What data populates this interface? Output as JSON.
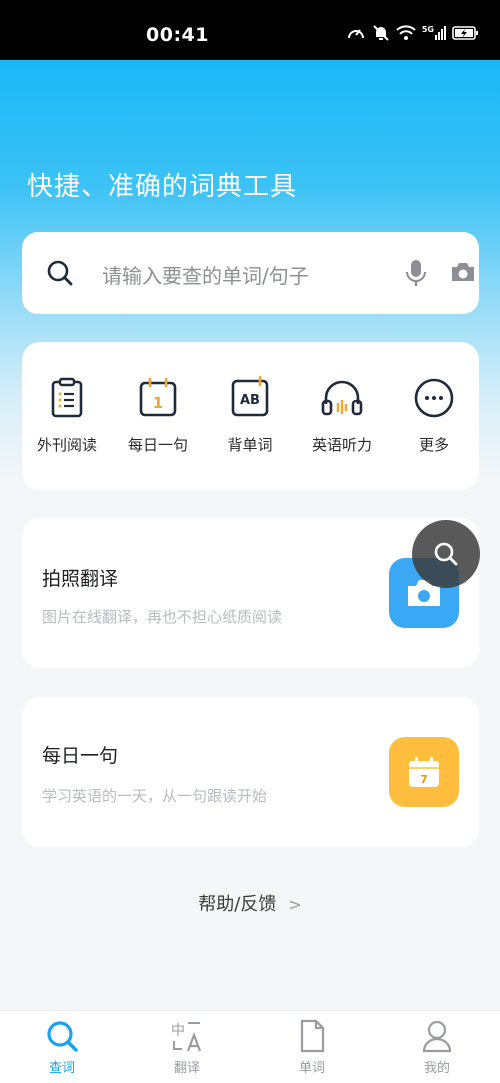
{
  "status_bar": {
    "time": "00:41",
    "icons": [
      "data-saver-icon",
      "mute-icon",
      "wifi-icon",
      "5g-signal-icon",
      "battery-charging-icon"
    ],
    "network_label": "5G"
  },
  "hero": {
    "title": "快捷、准确的词典工具"
  },
  "search": {
    "placeholder": "请输入要查的单词/句子",
    "icons": [
      "search-icon",
      "mic-icon",
      "camera-icon"
    ]
  },
  "quick_actions": [
    {
      "label": "外刊阅读",
      "icon": "clipboard-icon"
    },
    {
      "label": "每日一句",
      "icon": "calendar-day-icon",
      "icon_text": "1"
    },
    {
      "label": "背单词",
      "icon": "ab-card-icon",
      "icon_text": "AB"
    },
    {
      "label": "英语听力",
      "icon": "headphones-icon"
    },
    {
      "label": "更多",
      "icon": "more-icon"
    }
  ],
  "features": [
    {
      "title": "拍照翻译",
      "subtitle": "图片在线翻译，再也不担心纸质阅读",
      "icon": "camera-icon",
      "color": "#3aa8f5"
    },
    {
      "title": "每日一句",
      "subtitle": "学习英语的一天，从一句跟读开始",
      "icon": "calendar-icon",
      "icon_text": "7",
      "color": "#ffbd3d"
    }
  ],
  "help": {
    "label": "帮助/反馈",
    "chevron": ">"
  },
  "tabs": [
    {
      "label": "查词",
      "icon": "search-icon",
      "active": true
    },
    {
      "label": "翻译",
      "icon": "translate-icon",
      "active": false
    },
    {
      "label": "单词",
      "icon": "document-icon",
      "active": false
    },
    {
      "label": "我的",
      "icon": "person-icon",
      "active": false
    }
  ],
  "colors": {
    "accent": "#1aa2f2",
    "hero_top": "#1ab8f6",
    "icon_dark": "#1f2a3a",
    "icon_orange": "#f5a623"
  }
}
